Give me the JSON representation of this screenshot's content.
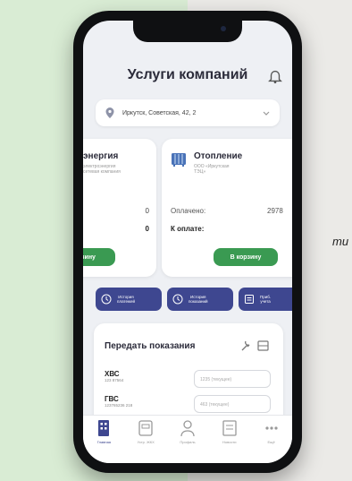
{
  "header": {
    "title": "Услуги компаний"
  },
  "address": {
    "text": "Иркутск, Советская, 42, 2"
  },
  "cards": {
    "left": {
      "title": "энергия",
      "subtitle": "электроэнергия\nсетевая компания",
      "row1_value": "0",
      "row2_value": "0",
      "button": "зину"
    },
    "right": {
      "title": "Отопление",
      "subtitle": "ООО «Иркутская\nТЭЦ»",
      "paid_label": "Оплачено:",
      "paid_value": "2978",
      "due_label": "К оплате:",
      "button": "В корзину"
    }
  },
  "history": [
    {
      "label": "История\nплатежей"
    },
    {
      "label": "История\nпоказаний"
    },
    {
      "label": "Приб.\nучета"
    }
  ],
  "meters": {
    "title": "Передать показания",
    "rows": [
      {
        "name": "ХВС",
        "number": "123 87564",
        "placeholder": "1235 (текущее)"
      },
      {
        "name": "ГВС",
        "number": "123765236 218",
        "placeholder": "463 (текущее)"
      }
    ]
  },
  "tabbar": {
    "items": [
      {
        "label": "Главная"
      },
      {
        "label": "Устр. ЖКХ"
      },
      {
        "label": "Профиль"
      },
      {
        "label": "Новости"
      },
      {
        "label": "Ещё"
      }
    ]
  },
  "background_text": "ти",
  "colors": {
    "accent": "#3e4790",
    "green": "#3a9a52",
    "screen_bg": "#eef0f4"
  }
}
